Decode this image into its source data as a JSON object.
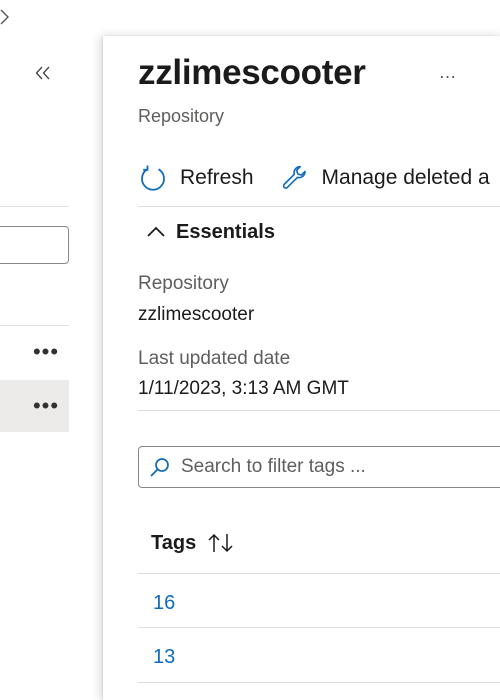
{
  "left_pane": {
    "top_chevron_icon": "chevron-right-icon",
    "collapse_icon": "double-chevron-left-icon",
    "rows": [
      {
        "more_label": "•••",
        "selected": false
      },
      {
        "more_label": "•••",
        "selected": true
      }
    ]
  },
  "blade": {
    "title": "zzlimescooter",
    "more_label": "…",
    "subtitle": "Repository",
    "toolbar": {
      "refresh_label": "Refresh",
      "refresh_icon": "refresh-icon",
      "manage_label": "Manage deleted a",
      "manage_icon": "wrench-icon"
    },
    "essentials": {
      "toggle_label": "Essentials",
      "toggle_icon": "chevron-up-icon",
      "fields": [
        {
          "label": "Repository",
          "value": "zzlimescooter"
        },
        {
          "label": "Last updated date",
          "value": "1/11/2023, 3:13 AM GMT"
        }
      ]
    },
    "search": {
      "placeholder": "Search to filter tags ...",
      "value": "",
      "icon": "search-icon"
    },
    "tags_table": {
      "header": "Tags",
      "sort_icon": "sort-up-down-icon",
      "rows": [
        "16",
        "13"
      ]
    }
  },
  "colors": {
    "accent": "#0f6cbd",
    "selected_row": "#edebe9",
    "secondary_text": "#605e5c",
    "divider": "#e1dfdd"
  }
}
